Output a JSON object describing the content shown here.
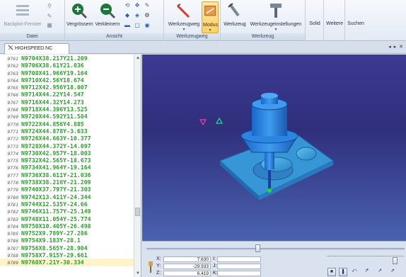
{
  "ribbon": {
    "groups": {
      "datei": "Datei",
      "ansicht": "Ansicht",
      "werkzeugweg": "Werkzeugweg",
      "werkzeug": "Werkzeug"
    },
    "buttons": {
      "backplot": "Backplot-Fenster",
      "vergroessern": "Vergrössern",
      "verkleinern": "Verkleinern",
      "werkzeugweg": "Werkzeugweg",
      "modus": "Modus",
      "werkzeug": "Werkzeug",
      "werkzeugeinstellungen": "Werkzeugeinstellungen",
      "solid": "Solid",
      "weitere": "Weitere",
      "suchen": "Suchen"
    },
    "colors": {
      "active": "#ffd064",
      "zoom_icon": "#1b7a3a"
    }
  },
  "tab": {
    "label": "HIGHSPEED.NC",
    "controls": "◂ ▸ ✕"
  },
  "code": {
    "lines": [
      {
        "n": "9761",
        "t": "N9704X38.217Y21.209"
      },
      {
        "n": "9762",
        "t": "N9706X38.61Y21.036"
      },
      {
        "n": "9763",
        "t": "N9708X41.966Y19.164"
      },
      {
        "n": "9764",
        "t": "N9710X42.56Y18.674"
      },
      {
        "n": "9765",
        "t": "N9712X42.956Y18.007"
      },
      {
        "n": "9766",
        "t": "N9714X44.22Y14.547"
      },
      {
        "n": "9767",
        "t": "N9716X44.32Y14.273"
      },
      {
        "n": "9768",
        "t": "N9718X44.396Y13.525"
      },
      {
        "n": "9769",
        "t": "N9720X44.592Y11.584"
      },
      {
        "n": "9770",
        "t": "N9722X44.856Y4.885"
      },
      {
        "n": "9771",
        "t": "N9724X44.878Y-3.633"
      },
      {
        "n": "9772",
        "t": "N9726X44.663Y-10.377"
      },
      {
        "n": "9773",
        "t": "N9728X44.372Y-14.097"
      },
      {
        "n": "9774",
        "t": "N9730X42.957Y-18.003"
      },
      {
        "n": "9775",
        "t": "N9732X42.565Y-18.673"
      },
      {
        "n": "9776",
        "t": "N9734X41.964Y-19.164"
      },
      {
        "n": "9777",
        "t": "N9736X38.611Y-21.036"
      },
      {
        "n": "9778",
        "t": "N9738X38.216Y-21.209"
      },
      {
        "n": "9779",
        "t": "N9740X37.797Y-21.303"
      },
      {
        "n": "9780",
        "t": "N9742X13.411Y-24.344"
      },
      {
        "n": "9781",
        "t": "N9744X12.535Y-24.66"
      },
      {
        "n": "9782",
        "t": "N9746X11.757Y-25.149"
      },
      {
        "n": "9783",
        "t": "N9748X11.054Y-25.774"
      },
      {
        "n": "9784",
        "t": "N9750X10.405Y-26.498"
      },
      {
        "n": "9785",
        "t": "N9752X9.789Y-27.286"
      },
      {
        "n": "9786",
        "t": "N9754X9.183Y-28.1"
      },
      {
        "n": "9787",
        "t": "N9756X8.565Y-28.904"
      },
      {
        "n": "9788",
        "t": "N9758X7.915Y-29.661"
      },
      {
        "n": "9789",
        "t": "N9760X7.21Y-30.334"
      }
    ],
    "colors": {
      "code": "#2aa12a",
      "current_line": "#fff3c8"
    }
  },
  "viewport": {
    "colors": {
      "bg_top": "#3c3a92",
      "bg_bottom": "#4a62b0",
      "part": "#3fa8e0",
      "tool": "#1e90ff"
    }
  },
  "coords": {
    "x_label": "X:",
    "x_value": "7.630",
    "y_label": "Y:",
    "y_value": "-29.933",
    "z_label": "Z:",
    "z_value": "6.419",
    "i_label": "I:",
    "j_label": "J:",
    "k_label": "K:"
  },
  "playback": {
    "timeline_progress": 0.43,
    "speed_level": 0.88,
    "buttons": [
      "stop-icon",
      "pause-icon",
      "step-back-icon",
      "step-icon",
      "step-forward-icon",
      "fast-forward-icon"
    ]
  }
}
